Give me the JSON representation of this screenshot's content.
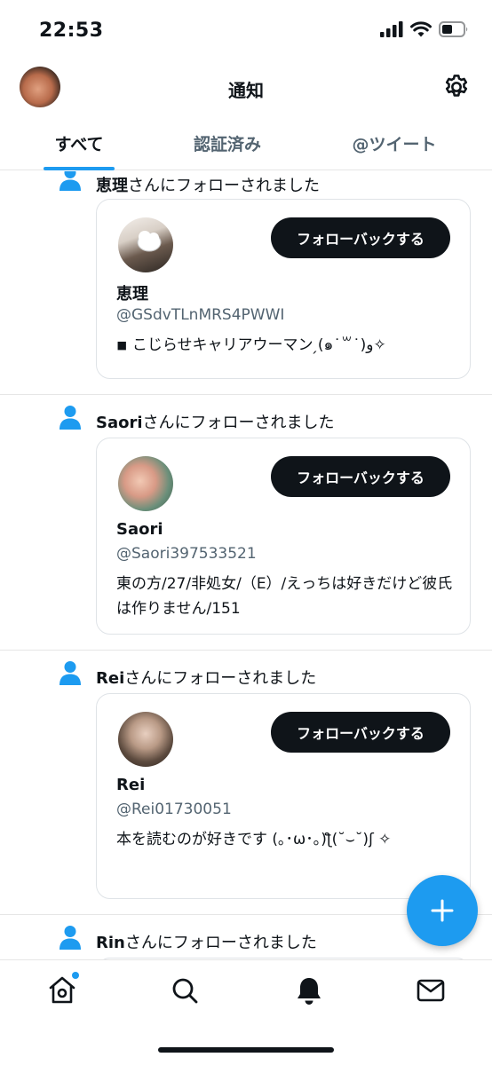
{
  "status_bar": {
    "time": "22:53"
  },
  "header": {
    "title": "通知",
    "avatar_icon": "profile-avatar",
    "settings_icon": "gear-icon"
  },
  "tabs": [
    {
      "label": "すべて",
      "active": true
    },
    {
      "label": "認証済み",
      "active": false
    },
    {
      "label": "@ツイート",
      "active": false
    }
  ],
  "notifications": [
    {
      "name": "恵理",
      "suffix": "さんにフォローされました",
      "card": {
        "display_name": "恵理",
        "handle": "@GSdvTLnMRS4PWWI",
        "bio": "◾ こじらせキャリアウーマン ̗(⁠๑˙꒳˙)و✧",
        "button_label": "フォローバックする"
      }
    },
    {
      "name": "Saori",
      "suffix": "さんにフォローされました",
      "card": {
        "display_name": "Saori",
        "handle": "@Saori397533521",
        "bio": "東の方/27/非処女/（E）/えっちは好きだけど彼氏は作りません/151",
        "button_label": "フォローバックする"
      }
    },
    {
      "name": "Rei",
      "suffix": "さんにフォローされました",
      "card": {
        "display_name": "Rei",
        "handle": "@Rei01730051",
        "bio": "本を読むのが好きです (｡･ω･｡)ƪ(˘⌣˘)ʃ ✧",
        "button_label": "フォローバックする"
      }
    },
    {
      "name": "Rin",
      "suffix": "さんにフォローされました"
    }
  ],
  "fab": {
    "icon": "plus-icon"
  },
  "bottom_nav": [
    {
      "icon": "home-icon",
      "has_dot": true
    },
    {
      "icon": "search-icon"
    },
    {
      "icon": "bell-icon",
      "active": true
    },
    {
      "icon": "mail-icon"
    }
  ],
  "colors": {
    "accent": "#1d9bf0",
    "text": "#0f1419",
    "muted": "#536471",
    "button": "#0f1419"
  }
}
